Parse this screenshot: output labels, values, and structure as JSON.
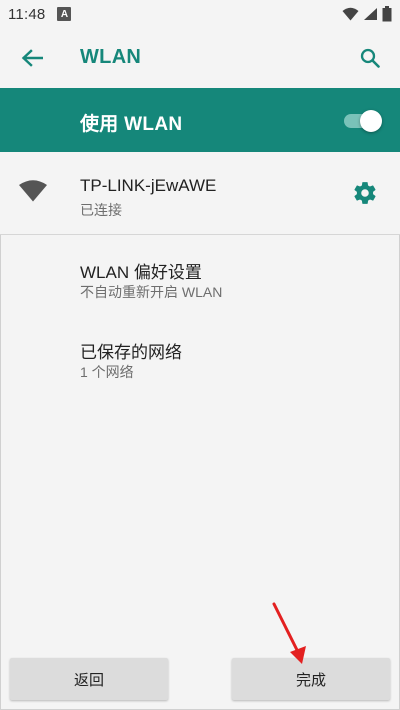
{
  "status_bar": {
    "time": "11:48",
    "app_badge": "A",
    "icons": [
      "wifi-icon",
      "signal-icon",
      "battery-icon"
    ]
  },
  "app_bar": {
    "title": "WLAN",
    "back_icon": "arrow-left-icon",
    "search_icon": "search-icon"
  },
  "master_switch": {
    "label": "使用 WLAN",
    "on": true
  },
  "connected_network": {
    "ssid": "TP-LINK-jEwAWE",
    "status": "已连接",
    "icon": "wifi-icon",
    "settings_icon": "gear-icon"
  },
  "preferences": [
    {
      "title": "WLAN 偏好设置",
      "subtitle": "不自动重新开启 WLAN"
    },
    {
      "title": "已保存的网络",
      "subtitle": "1 个网络"
    }
  ],
  "bottom_buttons": {
    "back_label": "返回",
    "done_label": "完成"
  },
  "colors": {
    "accent": "#15877a",
    "title_text": "#16877a",
    "background": "#f4f4f4",
    "annotation_arrow": "#e32020"
  }
}
